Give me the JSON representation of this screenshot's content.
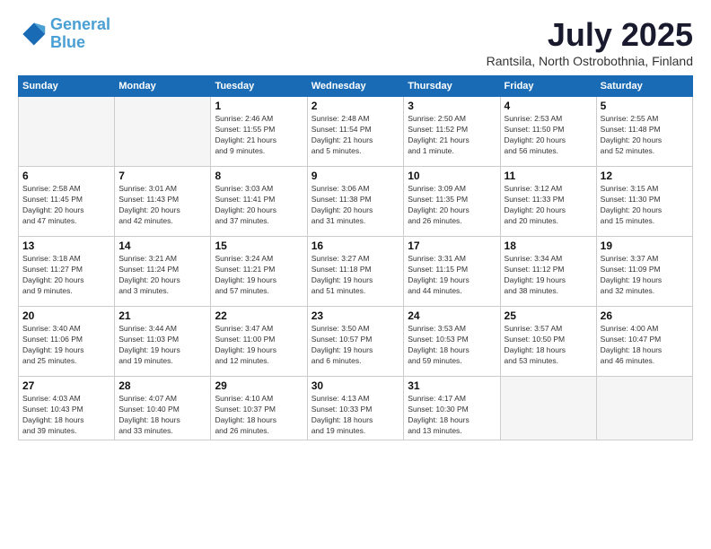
{
  "header": {
    "logo_line1": "General",
    "logo_line2": "Blue",
    "month": "July 2025",
    "location": "Rantsila, North Ostrobothnia, Finland"
  },
  "weekdays": [
    "Sunday",
    "Monday",
    "Tuesday",
    "Wednesday",
    "Thursday",
    "Friday",
    "Saturday"
  ],
  "weeks": [
    [
      {
        "day": "",
        "info": ""
      },
      {
        "day": "",
        "info": ""
      },
      {
        "day": "1",
        "info": "Sunrise: 2:46 AM\nSunset: 11:55 PM\nDaylight: 21 hours\nand 9 minutes."
      },
      {
        "day": "2",
        "info": "Sunrise: 2:48 AM\nSunset: 11:54 PM\nDaylight: 21 hours\nand 5 minutes."
      },
      {
        "day": "3",
        "info": "Sunrise: 2:50 AM\nSunset: 11:52 PM\nDaylight: 21 hours\nand 1 minute."
      },
      {
        "day": "4",
        "info": "Sunrise: 2:53 AM\nSunset: 11:50 PM\nDaylight: 20 hours\nand 56 minutes."
      },
      {
        "day": "5",
        "info": "Sunrise: 2:55 AM\nSunset: 11:48 PM\nDaylight: 20 hours\nand 52 minutes."
      }
    ],
    [
      {
        "day": "6",
        "info": "Sunrise: 2:58 AM\nSunset: 11:45 PM\nDaylight: 20 hours\nand 47 minutes."
      },
      {
        "day": "7",
        "info": "Sunrise: 3:01 AM\nSunset: 11:43 PM\nDaylight: 20 hours\nand 42 minutes."
      },
      {
        "day": "8",
        "info": "Sunrise: 3:03 AM\nSunset: 11:41 PM\nDaylight: 20 hours\nand 37 minutes."
      },
      {
        "day": "9",
        "info": "Sunrise: 3:06 AM\nSunset: 11:38 PM\nDaylight: 20 hours\nand 31 minutes."
      },
      {
        "day": "10",
        "info": "Sunrise: 3:09 AM\nSunset: 11:35 PM\nDaylight: 20 hours\nand 26 minutes."
      },
      {
        "day": "11",
        "info": "Sunrise: 3:12 AM\nSunset: 11:33 PM\nDaylight: 20 hours\nand 20 minutes."
      },
      {
        "day": "12",
        "info": "Sunrise: 3:15 AM\nSunset: 11:30 PM\nDaylight: 20 hours\nand 15 minutes."
      }
    ],
    [
      {
        "day": "13",
        "info": "Sunrise: 3:18 AM\nSunset: 11:27 PM\nDaylight: 20 hours\nand 9 minutes."
      },
      {
        "day": "14",
        "info": "Sunrise: 3:21 AM\nSunset: 11:24 PM\nDaylight: 20 hours\nand 3 minutes."
      },
      {
        "day": "15",
        "info": "Sunrise: 3:24 AM\nSunset: 11:21 PM\nDaylight: 19 hours\nand 57 minutes."
      },
      {
        "day": "16",
        "info": "Sunrise: 3:27 AM\nSunset: 11:18 PM\nDaylight: 19 hours\nand 51 minutes."
      },
      {
        "day": "17",
        "info": "Sunrise: 3:31 AM\nSunset: 11:15 PM\nDaylight: 19 hours\nand 44 minutes."
      },
      {
        "day": "18",
        "info": "Sunrise: 3:34 AM\nSunset: 11:12 PM\nDaylight: 19 hours\nand 38 minutes."
      },
      {
        "day": "19",
        "info": "Sunrise: 3:37 AM\nSunset: 11:09 PM\nDaylight: 19 hours\nand 32 minutes."
      }
    ],
    [
      {
        "day": "20",
        "info": "Sunrise: 3:40 AM\nSunset: 11:06 PM\nDaylight: 19 hours\nand 25 minutes."
      },
      {
        "day": "21",
        "info": "Sunrise: 3:44 AM\nSunset: 11:03 PM\nDaylight: 19 hours\nand 19 minutes."
      },
      {
        "day": "22",
        "info": "Sunrise: 3:47 AM\nSunset: 11:00 PM\nDaylight: 19 hours\nand 12 minutes."
      },
      {
        "day": "23",
        "info": "Sunrise: 3:50 AM\nSunset: 10:57 PM\nDaylight: 19 hours\nand 6 minutes."
      },
      {
        "day": "24",
        "info": "Sunrise: 3:53 AM\nSunset: 10:53 PM\nDaylight: 18 hours\nand 59 minutes."
      },
      {
        "day": "25",
        "info": "Sunrise: 3:57 AM\nSunset: 10:50 PM\nDaylight: 18 hours\nand 53 minutes."
      },
      {
        "day": "26",
        "info": "Sunrise: 4:00 AM\nSunset: 10:47 PM\nDaylight: 18 hours\nand 46 minutes."
      }
    ],
    [
      {
        "day": "27",
        "info": "Sunrise: 4:03 AM\nSunset: 10:43 PM\nDaylight: 18 hours\nand 39 minutes."
      },
      {
        "day": "28",
        "info": "Sunrise: 4:07 AM\nSunset: 10:40 PM\nDaylight: 18 hours\nand 33 minutes."
      },
      {
        "day": "29",
        "info": "Sunrise: 4:10 AM\nSunset: 10:37 PM\nDaylight: 18 hours\nand 26 minutes."
      },
      {
        "day": "30",
        "info": "Sunrise: 4:13 AM\nSunset: 10:33 PM\nDaylight: 18 hours\nand 19 minutes."
      },
      {
        "day": "31",
        "info": "Sunrise: 4:17 AM\nSunset: 10:30 PM\nDaylight: 18 hours\nand 13 minutes."
      },
      {
        "day": "",
        "info": ""
      },
      {
        "day": "",
        "info": ""
      }
    ]
  ]
}
